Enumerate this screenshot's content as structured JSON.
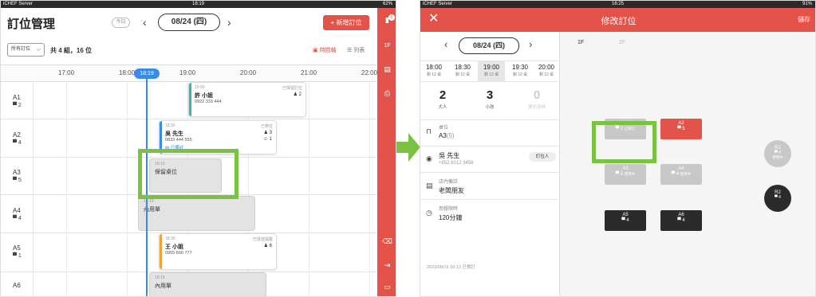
{
  "colors": {
    "accent": "#e4534a",
    "now": "#3b8be5",
    "highlight": "#7cc242",
    "dark_table": "#2b2b2b",
    "light_table": "#c8c8c8"
  },
  "left": {
    "status": {
      "carrier": "iCHEF Server",
      "time": "18:19",
      "right": "62%"
    },
    "title": "訂位管理",
    "today": "今日",
    "date": "08/24 (四)",
    "new_button": "+ 新增訂位",
    "filter": "所有訂位",
    "count": "共 4 組，16 位",
    "view_axis": "時間軸",
    "view_list": "列表",
    "times": [
      "17:00",
      "18:00",
      "19:00",
      "20:00",
      "21:00",
      "22:00"
    ],
    "now_time": "18:19",
    "rows": [
      {
        "name": "A1",
        "seats": "2"
      },
      {
        "name": "A2",
        "seats": "4"
      },
      {
        "name": "A3",
        "seats": "5"
      },
      {
        "name": "A4",
        "seats": "4"
      },
      {
        "name": "A5",
        "seats": "1"
      },
      {
        "name": "A6",
        "seats": ""
      }
    ],
    "reservations": {
      "a1": {
        "time": "19:00",
        "status": "已保留訂位",
        "name": "許 小姐",
        "phone": "0922 333 444",
        "people": "2"
      },
      "a2": {
        "time": "18:30",
        "status": "已帶位",
        "name": "吳 先生",
        "phone": "0833 444 555",
        "people": "3",
        "kids": "1",
        "note": "已備註"
      },
      "a3": {
        "time": "18:19",
        "name": "保留桌位"
      },
      "a4": {
        "time": "18:19",
        "name": "內用單"
      },
      "a5": {
        "time": "18:30",
        "status": "已發送提醒",
        "name": "王 小姐",
        "phone": "0955 666 777",
        "people": "6"
      },
      "a6": {
        "time": "18:19",
        "name": "內用單"
      }
    },
    "rail": {
      "badge": "0",
      "floor": "1F"
    }
  },
  "right": {
    "status": {
      "time": "16:25",
      "right": "91%"
    },
    "title": "修改訂位",
    "save": "儲存",
    "date": "08/24 (四)",
    "slots": [
      {
        "time": "18:00",
        "rest": "剩 12 桌"
      },
      {
        "time": "18:30",
        "rest": "剩 12 桌"
      },
      {
        "time": "19:00",
        "rest": "剩 12 桌"
      },
      {
        "time": "19:30",
        "rest": "剩 12 桌"
      },
      {
        "time": "20:00",
        "rest": "剩 12 桌"
      }
    ],
    "guests": [
      {
        "count": "2",
        "label": "大人"
      },
      {
        "count": "3",
        "label": "小孩"
      },
      {
        "count": "0",
        "label": "嬰兒座椅"
      }
    ],
    "table": {
      "label": "桌位",
      "value": "A3",
      "cap": "(5)"
    },
    "customer": {
      "name": "吳 先生",
      "phone": "+852 6012 3456",
      "tag": "訂位人"
    },
    "note": {
      "label": "店內備註",
      "value": "老闆朋友"
    },
    "duration": {
      "label": "用餐限時",
      "value": "120分鐘"
    },
    "footnote": "2023/08/16 16:13 已預訂",
    "floors": [
      "1F",
      "2F"
    ],
    "tables": {
      "a1": {
        "name": "A1",
        "seats": "2",
        "status": "已預訂"
      },
      "a2": {
        "name": "A2",
        "seats": "5"
      },
      "a3": {
        "name": "A3",
        "seats": "5",
        "status": "使用中"
      },
      "a4": {
        "name": "A4",
        "seats": "4",
        "status": "使用中"
      },
      "a5": {
        "name": "A5",
        "seats": "4"
      },
      "a6": {
        "name": "A6",
        "seats": "4"
      },
      "r1": {
        "name": "R1",
        "seats": "4",
        "status": "使用中"
      },
      "r2": {
        "name": "R2",
        "seats": "4"
      }
    }
  }
}
